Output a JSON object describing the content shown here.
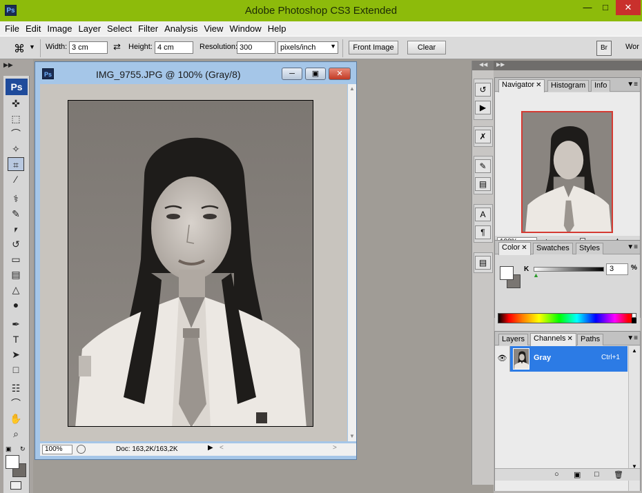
{
  "app": {
    "badge": "Ps",
    "title": "Adobe Photoshop CS3 Extended",
    "min": "—",
    "max": "□",
    "close": "✕"
  },
  "menu": [
    "File",
    "Edit",
    "Image",
    "Layer",
    "Select",
    "Filter",
    "Analysis",
    "View",
    "Window",
    "Help"
  ],
  "options": {
    "tool_icon": "crop-icon",
    "width_label": "Width:",
    "width_value": "3 cm",
    "height_label": "Height:",
    "height_value": "4 cm",
    "resolution_label": "Resolution:",
    "resolution_value": "300",
    "resolution_unit": "pixels/inch",
    "front_image": "Front Image",
    "clear": "Clear",
    "workspace": "Wor"
  },
  "toolbox": {
    "logo": "Ps",
    "tools": [
      {
        "name": "move-tool",
        "glyph": "✜"
      },
      {
        "name": "marquee-tool",
        "glyph": "⬚"
      },
      {
        "name": "lasso-tool",
        "glyph": "⌒"
      },
      {
        "name": "magic-wand-tool",
        "glyph": "✧"
      },
      {
        "name": "crop-tool",
        "glyph": "⌗",
        "active": true
      },
      {
        "name": "slice-tool",
        "glyph": "∕"
      },
      {
        "name": "healing-brush-tool",
        "glyph": "⚕"
      },
      {
        "name": "brush-tool",
        "glyph": "✎"
      },
      {
        "name": "clone-stamp-tool",
        "glyph": "⎖"
      },
      {
        "name": "history-brush-tool",
        "glyph": "↺"
      },
      {
        "name": "eraser-tool",
        "glyph": "▭"
      },
      {
        "name": "gradient-tool",
        "glyph": "▤"
      },
      {
        "name": "blur-tool",
        "glyph": "△"
      },
      {
        "name": "dodge-tool",
        "glyph": "●"
      },
      {
        "name": "pen-tool",
        "glyph": "✒"
      },
      {
        "name": "type-tool",
        "glyph": "T"
      },
      {
        "name": "path-selection-tool",
        "glyph": "➤"
      },
      {
        "name": "shape-tool",
        "glyph": "□"
      },
      {
        "name": "notes-tool",
        "glyph": "☷"
      },
      {
        "name": "eyedropper-tool",
        "glyph": "⌒"
      },
      {
        "name": "hand-tool",
        "glyph": "✋"
      },
      {
        "name": "zoom-tool",
        "glyph": "⌕"
      }
    ]
  },
  "document": {
    "title": "IMG_9755.JPG @ 100% (Gray/8)",
    "zoom": "100%",
    "doc_info": "Doc: 163,2K/163,2K"
  },
  "panels": {
    "navigator": {
      "tabs": [
        "Navigator",
        "Histogram",
        "Info"
      ],
      "zoom": "100%"
    },
    "color": {
      "tabs": [
        "Color",
        "Swatches",
        "Styles"
      ],
      "channel_label": "K",
      "value": "3",
      "unit": "%"
    },
    "layers": {
      "tabs": [
        "Layers",
        "Channels",
        "Paths"
      ],
      "channel_name": "Gray",
      "shortcut": "Ctrl+1"
    }
  },
  "colors": {
    "titlebar": "#8dbb0b",
    "selection": "#2c7be5",
    "nav_frame": "#d53a32"
  }
}
